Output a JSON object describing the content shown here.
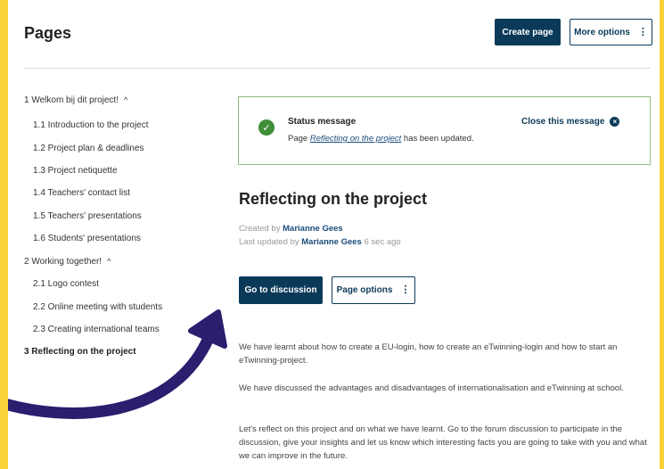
{
  "header": {
    "title": "Pages",
    "create_page_label": "Create page",
    "more_options_label": "More options",
    "kebab_glyph": "⋮"
  },
  "nav": {
    "items": [
      {
        "label": "1  Welkom bij dit project!",
        "chevron": "^"
      },
      {
        "label": "1.1  Introduction to the project"
      },
      {
        "label": "1.2  Project plan & deadlines"
      },
      {
        "label": "1.3  Project netiquette"
      },
      {
        "label": "1.4  Teachers' contact list"
      },
      {
        "label": "1.5  Teachers' presentations"
      },
      {
        "label": "1.6  Students' presentations"
      },
      {
        "label": "2  Working together!",
        "chevron": "^"
      },
      {
        "label": "2.1  Logo contest"
      },
      {
        "label": "2.2  Online meeting with students"
      },
      {
        "label": "2.3  Creating international teams"
      },
      {
        "label": "3  Reflecting on the project"
      }
    ]
  },
  "status": {
    "title": "Status message",
    "prefix": "Page ",
    "link": "Reflecting on the project",
    "suffix": " has been updated.",
    "close_label": "Close this message",
    "close_glyph": "×",
    "check_glyph": "✓"
  },
  "article": {
    "title": "Reflecting on the project",
    "created_prefix": "Created by ",
    "created_author": "Marianne Gees",
    "updated_prefix": "Last updated by ",
    "updated_author": "Marianne Gees",
    "updated_time": " 6 sec ago",
    "discussion_label": "Go to discussion",
    "page_options_label": "Page options",
    "paragraphs": [
      "We have learnt about how to create a EU-login, how to create an eTwinning-login and how to start an eTwinning-project.",
      "We have discussed the advantages and disadvantages of internationalisation and eTwinning at school.",
      "Let's reflect on this project and on what we have learnt. Go to the forum discussion to participate in the discussion, give your insights and let us know which interesting facts you are going to take with you and what we can improve in the future."
    ]
  },
  "colors": {
    "frame_border": "#f9d138",
    "primary": "#0b3a59",
    "success": "#3f8e3a",
    "arrow": "#2a1e6e"
  }
}
